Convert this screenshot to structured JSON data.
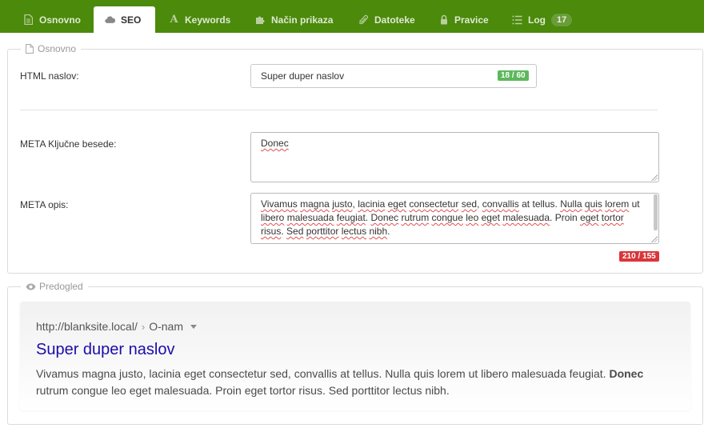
{
  "tabs": [
    {
      "label": "Osnovno",
      "icon": "document-icon",
      "active": false
    },
    {
      "label": "SEO",
      "icon": "cloud-icon",
      "active": true
    },
    {
      "label": "Keywords",
      "icon": "font-icon",
      "active": false
    },
    {
      "label": "Način prikaza",
      "icon": "puzzle-icon",
      "active": false
    },
    {
      "label": "Datoteke",
      "icon": "paperclip-icon",
      "active": false
    },
    {
      "label": "Pravice",
      "icon": "lock-icon",
      "active": false
    },
    {
      "label": "Log",
      "icon": "list-icon",
      "active": false,
      "count": "17"
    }
  ],
  "osnovno": {
    "legend": "Osnovno",
    "html_title": {
      "label": "HTML naslov:",
      "value": "Super duper naslov",
      "counter": "18 / 60"
    },
    "meta_keywords": {
      "label": "META Ključne besede:",
      "value": "Donec"
    },
    "meta_description": {
      "label": "META opis:",
      "value": "Vivamus magna justo, lacinia eget consectetur sed, convallis at tellus. Nulla quis lorem ut libero malesuada feugiat. Donec rutrum congue leo eget malesuada. Proin eget tortor risus. Sed porttitor lectus nibh.",
      "counter": "210 / 155"
    }
  },
  "predogled": {
    "legend": "Predogled",
    "url": "http://blanksite.local/",
    "breadcrumb": "O-nam",
    "title": "Super duper naslov",
    "description_before": "Vivamus magna justo, lacinia eget consectetur sed, convallis at tellus. Nulla quis lorem ut libero malesuada feugiat.",
    "description_bold": "Donec",
    "description_after": "rutrum congue leo eget malesuada. Proin eget tortor risus. Sed porttitor lectus nibh."
  },
  "colors": {
    "header": "#4b8a0b",
    "ok": "#5cb85c",
    "over": "#d9363a",
    "link": "#1a0dab"
  }
}
